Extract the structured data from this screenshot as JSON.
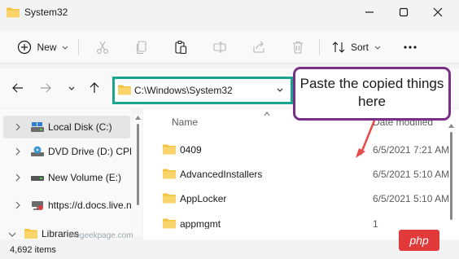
{
  "window": {
    "title": "System32"
  },
  "toolbar": {
    "new_label": "New",
    "sort_label": "Sort"
  },
  "address": {
    "path": "C:\\Windows\\System32"
  },
  "sidebar": {
    "items": [
      {
        "label": "Local Disk (C:)",
        "icon": "drive-icon"
      },
      {
        "label": "DVD Drive (D:) CPR",
        "icon": "dvd-drive-icon"
      },
      {
        "label": "New Volume (E:)",
        "icon": "drive-icon"
      },
      {
        "label": "https://d.docs.live.n",
        "icon": "network-drive-icon"
      },
      {
        "label": "Libraries",
        "icon": "folder-icon"
      }
    ]
  },
  "columns": {
    "name": "Name",
    "date": "Date modified"
  },
  "files": [
    {
      "name": "0409",
      "date": "6/5/2021 7:21 AM"
    },
    {
      "name": "AdvancedInstallers",
      "date": "6/5/2021 5:10 AM"
    },
    {
      "name": "AppLocker",
      "date": "6/5/2021 5:10 AM"
    },
    {
      "name": "appmgmt",
      "date": "1"
    }
  ],
  "status": {
    "item_count": "4,692 items"
  },
  "annotation": {
    "text": "Paste the copied things here",
    "border_color": "#7a2f86",
    "arrow_color": "#e84a4a"
  },
  "watermark": {
    "text": "thegeekpage.com",
    "badge": "php"
  },
  "colors": {
    "address_highlight": "#19a58d",
    "folder": "#f5c342"
  }
}
